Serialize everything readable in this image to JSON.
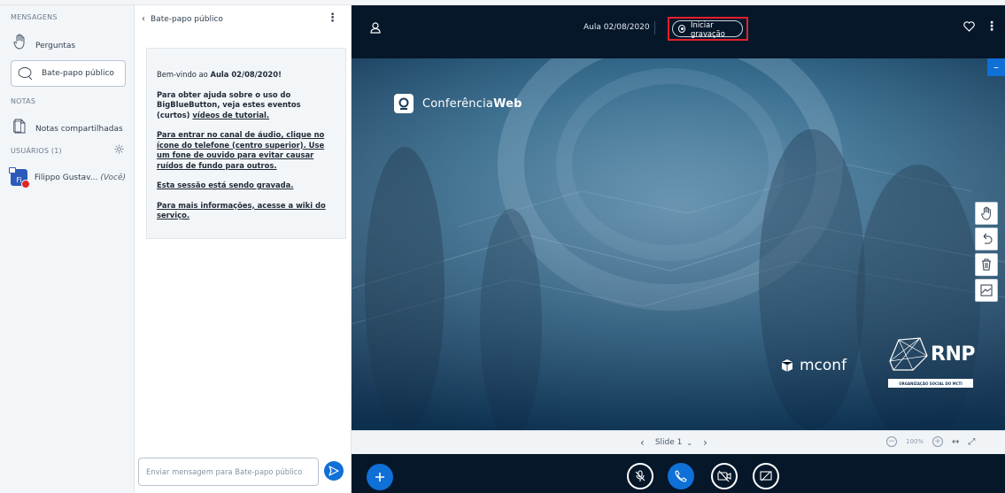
{
  "userlist": {
    "messages_title": "MENSAGENS",
    "questions_label": "Perguntas",
    "public_chat_label": "Bate-papo público",
    "notes_title": "NOTAS",
    "shared_notes_label": "Notas compartilhadas",
    "users_title": "USUÁRIOS (1)",
    "user": {
      "initials": "Fi",
      "name": "Filippo Gustav...",
      "you_tag": "(Você)"
    }
  },
  "chat": {
    "back_label": "Bate-papo público",
    "welcome": {
      "line1_prefix": "Bem-vindo ao ",
      "line1_bold": "Aula 02/08/2020!",
      "para2": "Para obter ajuda sobre o uso do BigBlueButton, veja estes eventos (curtos) ",
      "para2_link": "vídeos de tutorial.",
      "para3": "Para entrar no canal de áudio, clique no ícone do telefone (centro superior). Use um fone de ouvido para evitar causar ruídos de fundo para outros.",
      "para4": "Esta sessão está sendo gravada.",
      "para5_prefix": "Para mais informações, acesse a ",
      "para5_link": "wiki do serviço."
    },
    "input_placeholder": "Enviar mensagem para Bate-papo público"
  },
  "presentation": {
    "meeting_title": "Aula 02/08/2020",
    "record_label": "Iniciar gravação",
    "brand_conferencia_light": "Conferência",
    "brand_conferencia_bold": "Web",
    "brand_mconf": "mconf",
    "brand_rnp": "RNP",
    "brand_rnp_sub": "ORGANIZAÇÃO SOCIAL DO MCTI",
    "slide_label": "Slide 1",
    "zoom_value": "100%"
  },
  "colors": {
    "accent": "#0f70d7",
    "record_highlight": "#e31f2b",
    "dark_bg": "#06172a"
  }
}
